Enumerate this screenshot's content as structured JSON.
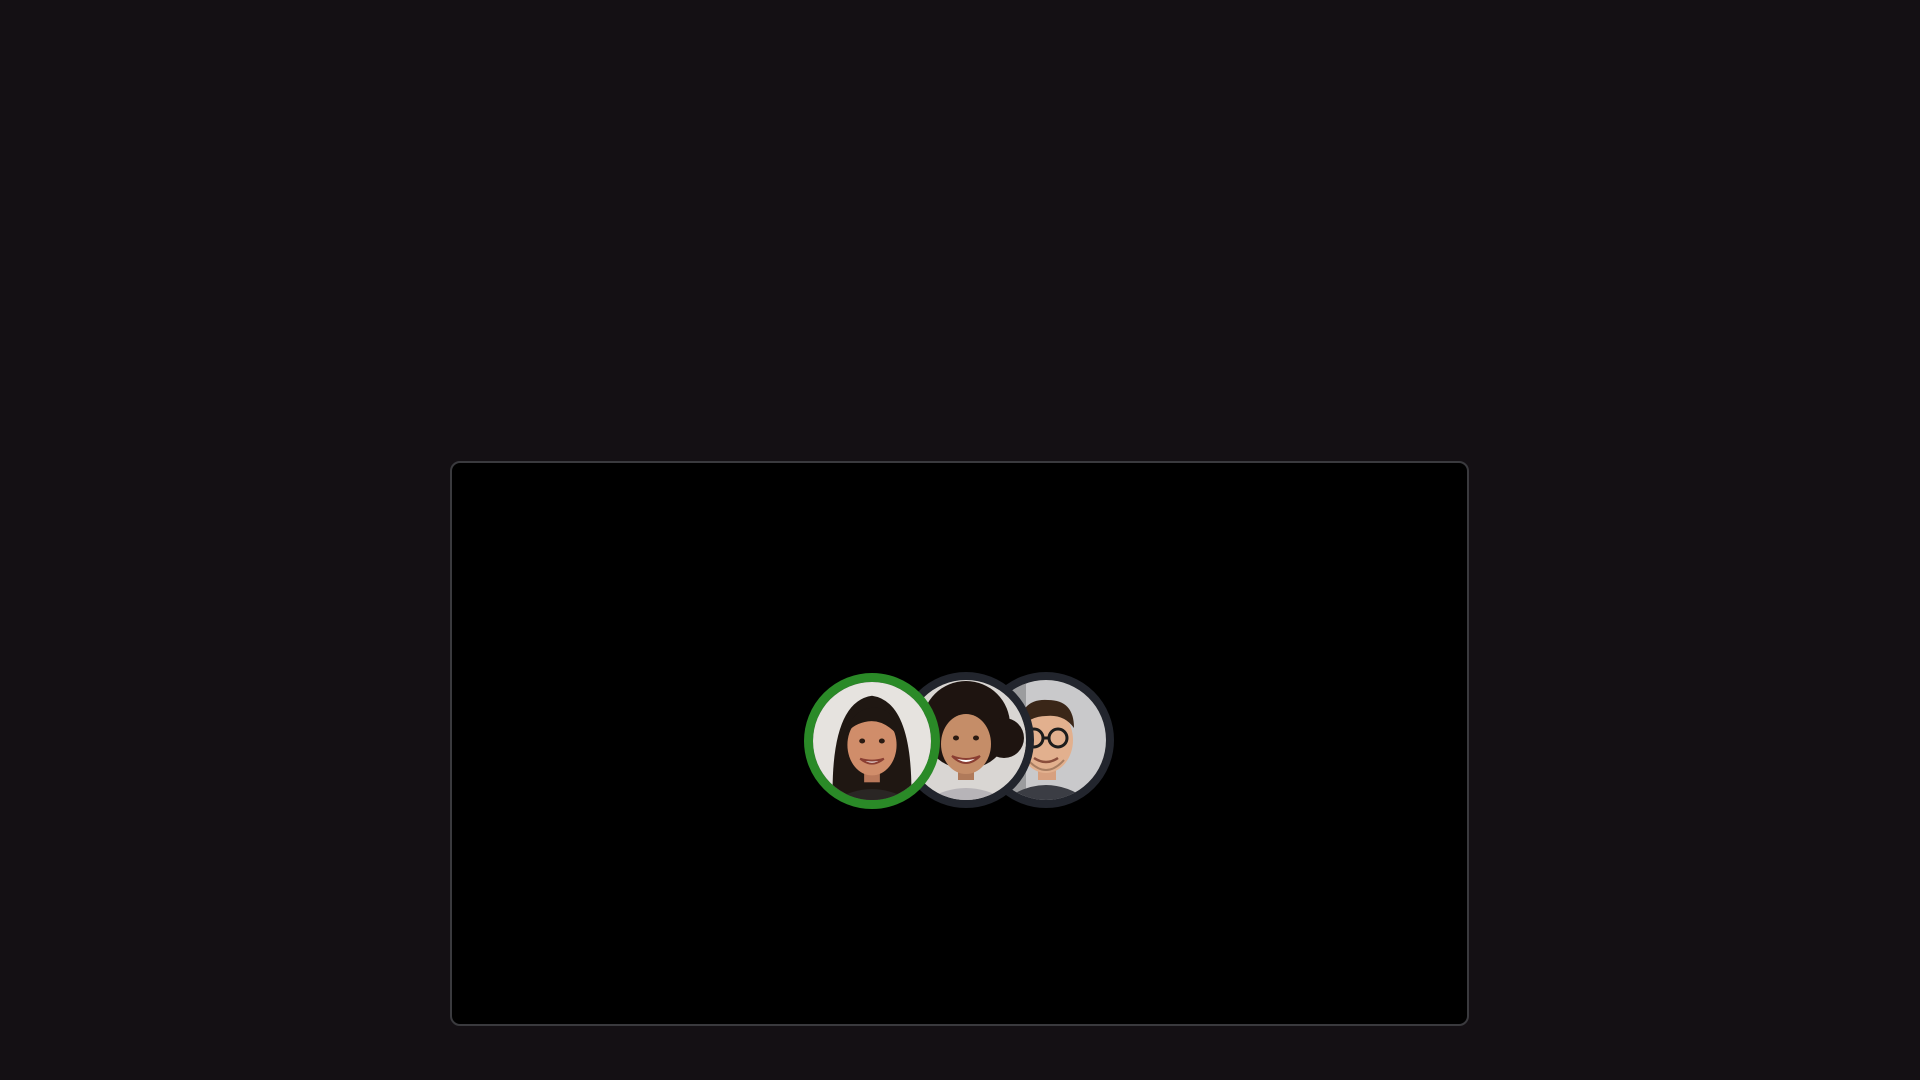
{
  "call": {
    "participants": [
      {
        "name_icon": "participant-avatar-icon",
        "speaking": true
      },
      {
        "name_icon": "participant-avatar-icon",
        "speaking": false
      },
      {
        "name_icon": "participant-avatar-icon",
        "speaking": false
      }
    ]
  },
  "colors": {
    "page_background": "#141014",
    "stage_background": "#000000",
    "stage_border": "#3a3a3e",
    "speaking_ring": "#2a8a27",
    "idle_ring": "#22252d"
  }
}
